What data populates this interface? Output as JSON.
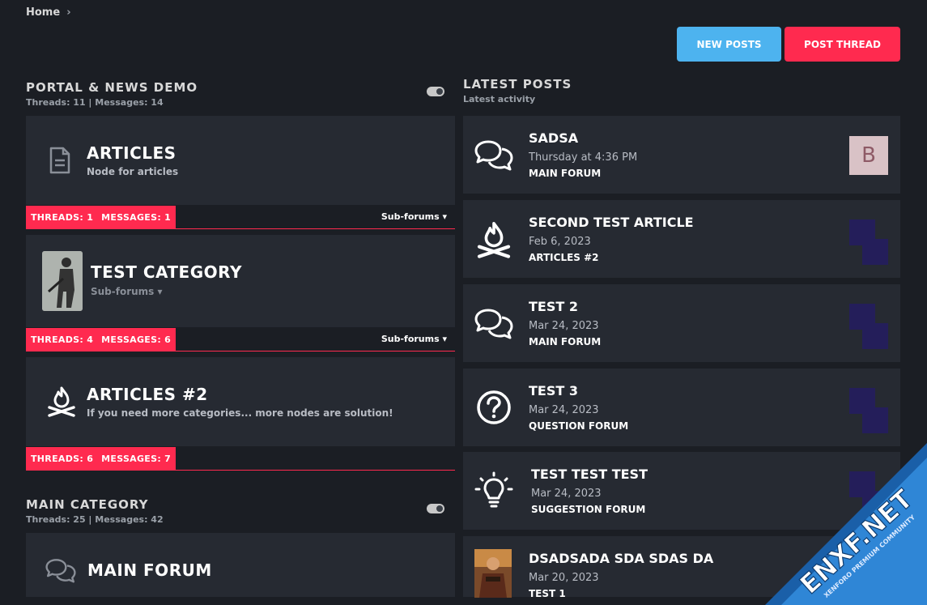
{
  "breadcrumb": {
    "home": "Home"
  },
  "buttons": {
    "new_posts": "NEW POSTS",
    "post_thread": "POST THREAD"
  },
  "categories": [
    {
      "title": "PORTAL & NEWS DEMO",
      "stats": "Threads: 11 | Messages: 14"
    },
    {
      "title": "MAIN CATEGORY",
      "stats": "Threads: 25 | Messages: 42"
    }
  ],
  "nodes": [
    {
      "title": "ARTICLES",
      "desc": "Node for articles",
      "icon": "document-icon",
      "threads": "THREADS: 1",
      "messages": "MESSAGES: 1",
      "subforums": "Sub-forums ▾"
    },
    {
      "title": "TEST CATEGORY",
      "desc": "Sub-forums ▾",
      "icon": "soldier-thumbnail",
      "threads": "THREADS: 4",
      "messages": "MESSAGES: 6",
      "subforums": "Sub-forums ▾"
    },
    {
      "title": "ARTICLES #2",
      "desc": "If you need more categories... more nodes are solution!",
      "icon": "campfire-icon",
      "threads": "THREADS: 6",
      "messages": "MESSAGES: 7",
      "subforums": ""
    },
    {
      "title": "MAIN FORUM",
      "desc": "",
      "icon": "comments-icon"
    }
  ],
  "latest": {
    "title": "LATEST POSTS",
    "subtitle": "Latest activity",
    "posts": [
      {
        "title": "SADSA",
        "date": "Thursday at 4:36 PM",
        "forum": "MAIN FORUM",
        "icon": "comments-icon",
        "avatar": "B"
      },
      {
        "title": "SECOND TEST ARTICLE",
        "date": "Feb 6, 2023",
        "forum": "ARTICLES #2",
        "icon": "campfire-icon"
      },
      {
        "title": "TEST 2",
        "date": "Mar 24, 2023",
        "forum": "MAIN FORUM",
        "icon": "comments-icon"
      },
      {
        "title": "TEST 3",
        "date": "Mar 24, 2023",
        "forum": "QUESTION FORUM",
        "icon": "question-icon"
      },
      {
        "title": "TEST TEST TEST",
        "date": "Mar 24, 2023",
        "forum": "SUGGESTION FORUM",
        "icon": "lightbulb-icon"
      },
      {
        "title": "DSADSADA SDA SDAS DA",
        "date": "Mar 20, 2023",
        "forum": "TEST 1",
        "icon": "thumbnail"
      }
    ]
  },
  "watermark": {
    "brand": "ENXF.NET",
    "tagline": "XENFORO PREMIUM COMMUNITY"
  },
  "colors": {
    "background": "#1b1e24",
    "card": "#262a32",
    "accent_red": "#ff2a4f",
    "accent_blue": "#4db3ef"
  }
}
